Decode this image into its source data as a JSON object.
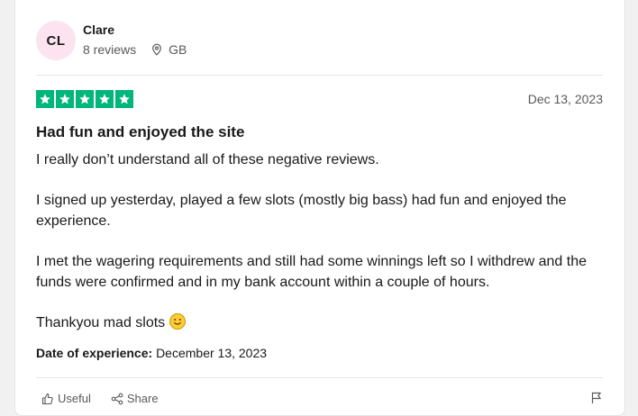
{
  "reviewer": {
    "initials": "CL",
    "name": "Clare",
    "reviews_count": "8 reviews",
    "country": "GB"
  },
  "review": {
    "rating": 5,
    "date": "Dec 13, 2023",
    "title": "Had fun and enjoyed the site",
    "paragraphs": [
      "I really don’t understand all of these negative reviews.",
      "I signed up yesterday, played a few slots (mostly big bass) had fun and enjoyed the experience.",
      "I met the wagering requirements and still had some winnings left so I withdrew and the funds were confirmed and in my bank account within a couple of hours.",
      "Thankyou mad slots"
    ],
    "experience_label": "Date of experience:",
    "experience_date": "December 13, 2023"
  },
  "actions": {
    "useful_label": "Useful",
    "share_label": "Share"
  },
  "colors": {
    "star_green": "#00b67a",
    "avatar_bg": "#fde3ef"
  }
}
